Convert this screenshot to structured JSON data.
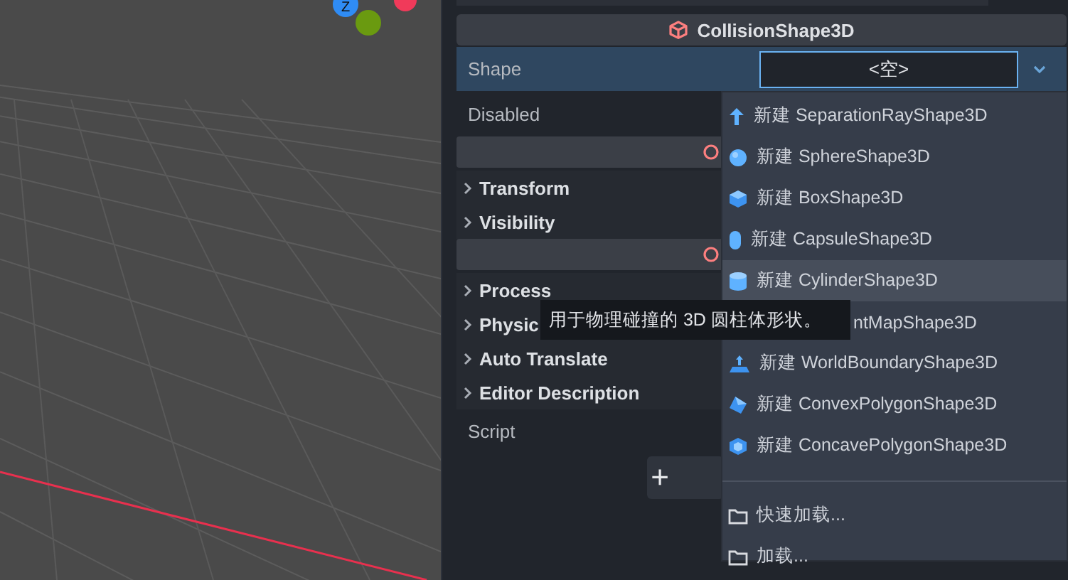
{
  "viewport": {
    "gizmo": [
      {
        "label": "Z",
        "color": "#2f8cf5"
      },
      {
        "color": "#6a9a10"
      },
      {
        "color": "#f03a5a"
      }
    ]
  },
  "inspector": {
    "title": "CollisionShape3D",
    "shape": {
      "label": "Shape",
      "value": "<空>"
    },
    "disabled": {
      "label": "Disabled"
    },
    "sections": [
      {
        "kind": "group"
      },
      {
        "kind": "section",
        "label": "Transform"
      },
      {
        "kind": "section",
        "label": "Visibility"
      },
      {
        "kind": "group"
      },
      {
        "kind": "section",
        "label": "Process"
      },
      {
        "kind": "section",
        "label": "Physic"
      },
      {
        "kind": "section",
        "label": "Auto Translate"
      },
      {
        "kind": "section",
        "label": "Editor Description"
      }
    ],
    "script": {
      "label": "Script",
      "button": "+"
    }
  },
  "menu": {
    "items": [
      {
        "kind": "ray",
        "label": "新建 SeparationRayShape3D",
        "selected": false
      },
      {
        "kind": "sphere",
        "label": "新建 SphereShape3D",
        "selected": false
      },
      {
        "kind": "box",
        "label": "新建 BoxShape3D",
        "selected": false
      },
      {
        "kind": "capsule",
        "label": "新建 CapsuleShape3D",
        "selected": false
      },
      {
        "kind": "cylinder",
        "label": "新建 CylinderShape3D",
        "selected": true
      },
      {
        "kind": "covered",
        "label": "ntMapShape3D",
        "selected": false
      },
      {
        "kind": "plane",
        "label": "新建 WorldBoundaryShape3D",
        "selected": false
      },
      {
        "kind": "convex",
        "label": "新建 ConvexPolygonShape3D",
        "selected": false
      },
      {
        "kind": "concave",
        "label": "新建 ConcavePolygonShape3D",
        "selected": false
      },
      {
        "kind": "separator"
      },
      {
        "kind": "folder",
        "label": "快速加载...",
        "selected": false
      },
      {
        "kind": "folder",
        "label": "加载...",
        "selected": false
      }
    ]
  },
  "tooltip": "用于物理碰撞的 3D 圆柱体形状。"
}
